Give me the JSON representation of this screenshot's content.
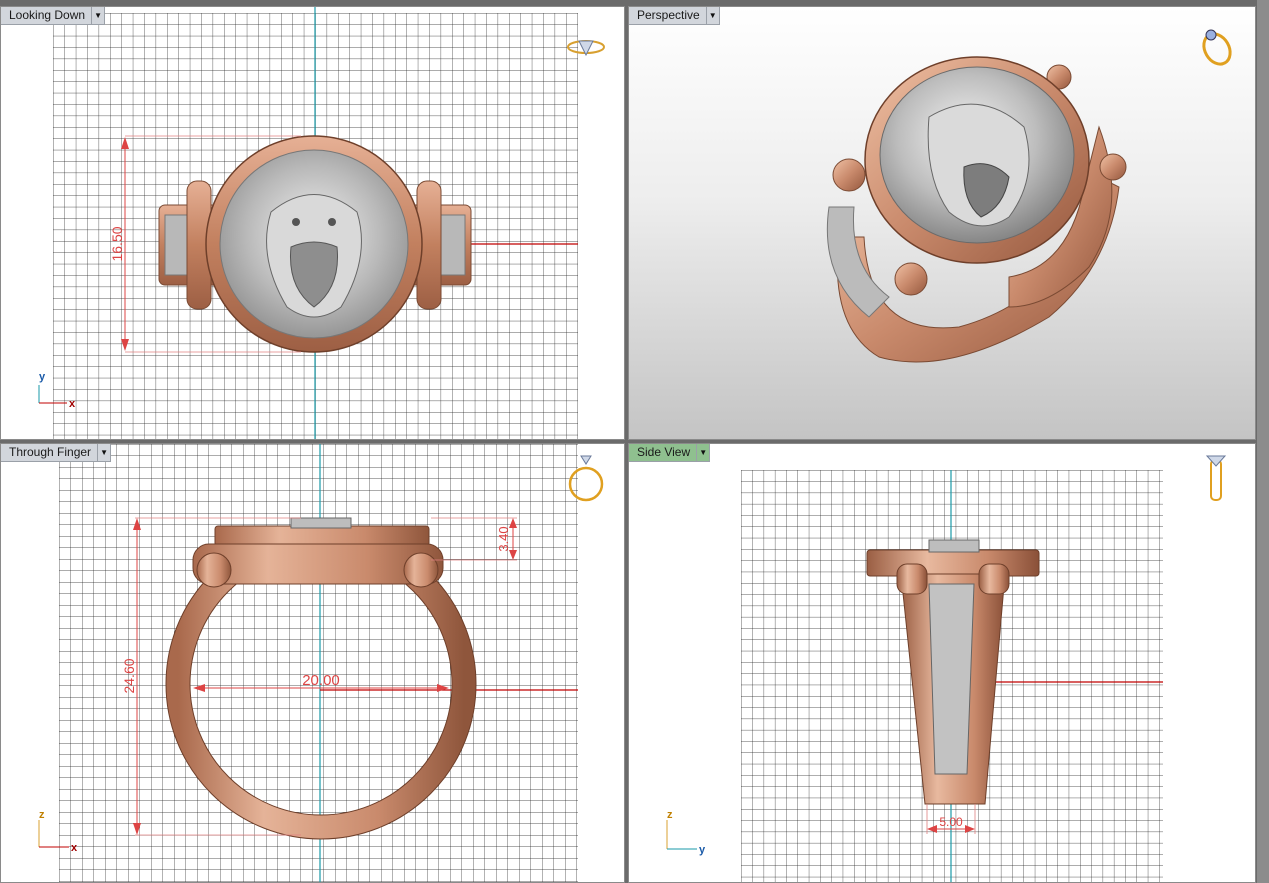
{
  "viewports": {
    "top": {
      "title": "Looking Down",
      "dimensions": [
        "16.50"
      ],
      "axes": [
        "y",
        "x"
      ],
      "icon": "ring-top-icon"
    },
    "perspective": {
      "title": "Perspective",
      "icon": "ring-perspective-icon"
    },
    "front": {
      "title": "Through Finger",
      "dimensions": [
        "24.60",
        "20.00",
        "3.40"
      ],
      "axes": [
        "z",
        "x"
      ],
      "icon": "ring-front-icon"
    },
    "side": {
      "title": "Side View",
      "dimensions": [
        "5.00"
      ],
      "axes": [
        "z",
        "y"
      ],
      "icon": "ring-side-icon"
    }
  },
  "colors": {
    "rose_gold": "#c98a6c",
    "silver": "#c8c8c8",
    "dimension": "#d44",
    "axis_x": "#c00000",
    "axis_y": "#1a9aa8",
    "grid": "#1a1a1a",
    "active_tab": "#8fc08f"
  }
}
